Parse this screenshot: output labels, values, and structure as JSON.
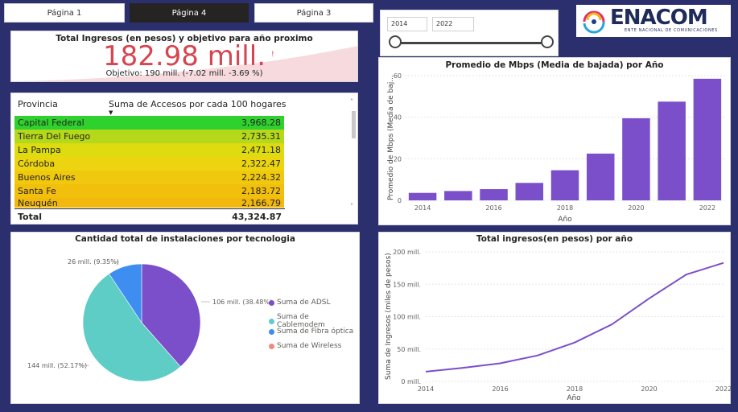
{
  "tabs": [
    "Página 1",
    "Página 4",
    "Página 3"
  ],
  "kpi": {
    "title": "Total Ingresos (en pesos) y objetivo para año proximo",
    "value": "182.98 mill.",
    "indicator": "!",
    "goal": "Objetivo: 190 mill. (-7.02 mill. -3.69 %)"
  },
  "slicer": {
    "from": "2014",
    "to": "2022",
    "range": [
      0,
      1
    ]
  },
  "logo": {
    "text": "ENACOM",
    "subtitle": "ENTE NACIONAL DE COMUNICACIONES"
  },
  "table": {
    "col1": "Provincia",
    "col2": "Suma de Accesos por cada 100 hogares",
    "rows": [
      {
        "name": "Capital Federal",
        "value": "3,968.28",
        "color": "#2ed12e"
      },
      {
        "name": "Tierra Del Fuego",
        "value": "2,735.31",
        "color": "#b5d81a"
      },
      {
        "name": "La Pampa",
        "value": "2,471.18",
        "color": "#dcdc10"
      },
      {
        "name": "Córdoba",
        "value": "2,322.47",
        "color": "#ecd510"
      },
      {
        "name": "Buenos Aires",
        "value": "2,224.32",
        "color": "#f0c80e"
      },
      {
        "name": "Santa Fe",
        "value": "2,183.72",
        "color": "#f2bf0d"
      },
      {
        "name": "Neuquén",
        "value": "2,166.79",
        "color": "#f2b80d"
      }
    ],
    "total_label": "Total",
    "total_value": "43,324.87"
  },
  "bar_chart": {
    "title": "Promedio de Mbps (Media de bajada) por Año",
    "xlabel": "Año",
    "ylabel": "Promedio de Mbps (Media de baj...",
    "yticks": [
      "0",
      "20",
      "40",
      "60"
    ],
    "xticks": [
      "2014",
      "2016",
      "2018",
      "2020",
      "2022"
    ]
  },
  "pie_chart": {
    "title": "Cantidad total de instalaciones por tecnologia",
    "labels": [
      "106 mill. (38.48%)",
      "144 mill. (52.17%)",
      "26 mill. (9.35%)"
    ],
    "legend": [
      "Suma de ADSL",
      "Suma de Cablemodem",
      "Suma de Fibra óptica",
      "Suma de Wireless"
    ]
  },
  "line_chart": {
    "title": "Total ingresos(en pesos) por año",
    "xlabel": "Año",
    "ylabel": "Suma de Ingresos (miles de pesos)",
    "yticks": [
      "0 mill.",
      "50 mill.",
      "100 mill.",
      "150 mill.",
      "200 mill."
    ],
    "xticks": [
      "2014",
      "2016",
      "2018",
      "2020",
      "2022"
    ]
  },
  "chart_data": [
    {
      "type": "bar",
      "title": "Promedio de Mbps (Media de bajada) por Año",
      "xlabel": "Año",
      "ylabel": "Promedio de Mbps (Media de baj...",
      "categories": [
        2014,
        2015,
        2016,
        2017,
        2018,
        2019,
        2020,
        2021,
        2022
      ],
      "values": [
        3.6,
        4.5,
        5.4,
        8.4,
        14.5,
        22.5,
        39.5,
        47.5,
        58.5
      ],
      "ylim": [
        0,
        60
      ],
      "color": "#7b4fc9"
    },
    {
      "type": "pie",
      "title": "Cantidad total de instalaciones por tecnologia",
      "categories": [
        "Suma de ADSL",
        "Suma de Cablemodem",
        "Suma de Fibra óptica",
        "Suma de Wireless"
      ],
      "values": [
        38.48,
        52.17,
        9.35,
        0
      ],
      "colors": [
        "#7b4fc9",
        "#5ecdc6",
        "#3d8ef0",
        "#f08a7b"
      ]
    },
    {
      "type": "line",
      "title": "Total ingresos(en pesos) por año",
      "xlabel": "Año",
      "ylabel": "Suma de Ingresos (miles de pesos)",
      "x": [
        2014,
        2015,
        2016,
        2017,
        2018,
        2019,
        2020,
        2021,
        2022
      ],
      "y": [
        15,
        21,
        28,
        40,
        60,
        88,
        128,
        165,
        183
      ],
      "ylim": [
        0,
        200
      ],
      "color": "#7b4fc9"
    }
  ]
}
